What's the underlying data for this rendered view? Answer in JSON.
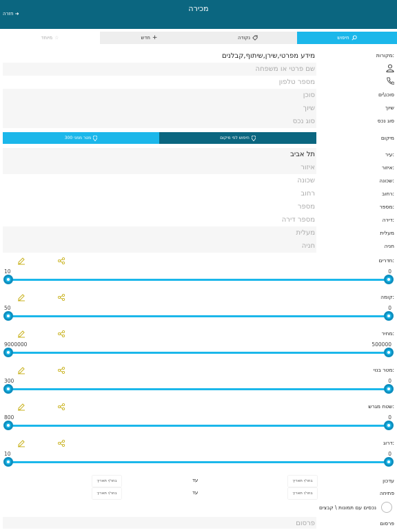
{
  "header": {
    "title": "מכירה",
    "back_label": "חזרה ➜"
  },
  "tabs": [
    {
      "label": "חיפוש"
    },
    {
      "label": "נקודה"
    },
    {
      "label": "חדש"
    },
    {
      "label": "מיוחד"
    }
  ],
  "labels": {
    "sources": "מקורות:",
    "agents": "סוכנ\\ים",
    "assignment": "שיוך",
    "asset_type": "סוג נכס",
    "location": "מיקום",
    "city": "עיר:",
    "area": "איזור:",
    "neighborhood": "שכונה:",
    "street": "רחוב:",
    "number": "מספר:",
    "apartment": "דירה:",
    "elevator": "מעלית",
    "parking": "חניה",
    "updated": "עדכון",
    "opened": "פתיחה",
    "with_images": "נכסים עם תמונות \\ קבצים",
    "publish": "פרסום"
  },
  "fields": {
    "sources": "מידע מפרטי,שירן,שיתוף,קבלנים",
    "name_placeholder": "שם פרטי או משפחה",
    "phone_placeholder": "מספר טלפון",
    "agent_placeholder": "סוכן",
    "assignment_placeholder": "שיוך",
    "asset_type_placeholder": "סוג נכס",
    "city": "תל אביב",
    "area_placeholder": "איזור",
    "neighborhood_placeholder": "שכונה",
    "street_placeholder": "רחוב",
    "number_placeholder": "מספר",
    "apartment_placeholder": "מספר דירה",
    "elevator_placeholder": "מעלית",
    "parking_placeholder": "חניה",
    "publish_placeholder": "פרסום"
  },
  "location_toggle": {
    "by_location": "חיפוש לפי מיקום",
    "nearby": "300 מטר ממני"
  },
  "sliders": [
    {
      "label": "חדרים:",
      "min": "0",
      "max": "10"
    },
    {
      "label": "קומה:",
      "min": "0",
      "max": "50"
    },
    {
      "label": "מחיר:",
      "min": "500000",
      "max": "9000000"
    },
    {
      "label": "מטר בנוי:",
      "min": "0",
      "max": "300"
    },
    {
      "label": "שטח מגרש:",
      "min": "0",
      "max": "800"
    },
    {
      "label": "דרוג:",
      "min": "0",
      "max": "10"
    }
  ],
  "dates": {
    "choose": "בחר/י תאריך",
    "until": "עד"
  },
  "colors": {
    "header": "#0b6680",
    "accent": "#1bb7ea",
    "edit_icon": "#c9b21e"
  }
}
